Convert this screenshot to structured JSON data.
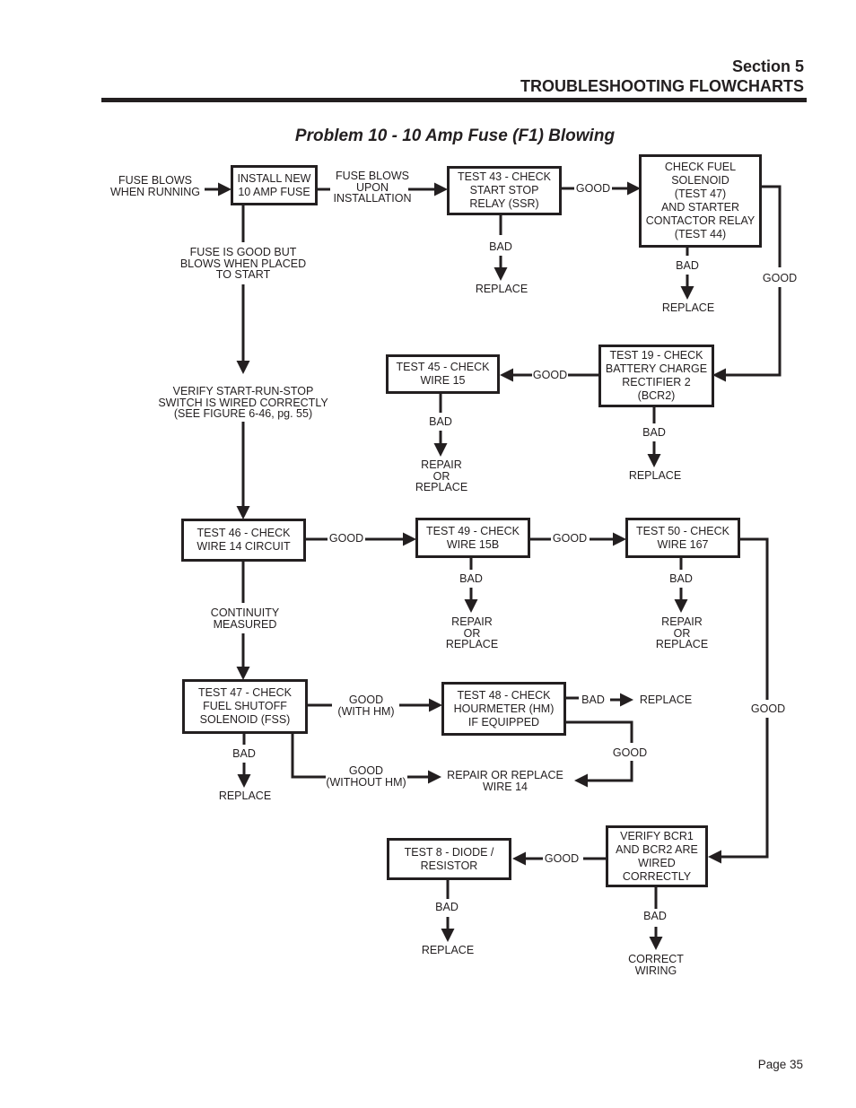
{
  "header": {
    "section": "Section 5",
    "chapter": "TROUBLESHOOTING FLOWCHARTS"
  },
  "title": "Problem 10 -  10 Amp Fuse (F1) Blowing",
  "boxes": {
    "install": "INSTALL NEW\n10 AMP FUSE",
    "t43": "TEST 43 - CHECK\nSTART STOP\nRELAY (SSR)",
    "fuel": "CHECK FUEL\nSOLENOID\n(TEST 47)\nAND STARTER\nCONTACTOR RELAY\n(TEST 44)",
    "t19": "TEST 19 - CHECK\nBATTERY CHARGE\nRECTIFIER 2\n(BCR2)",
    "t45": "TEST 45 - CHECK\nWIRE 15",
    "t46": "TEST 46 - CHECK\nWIRE 14 CIRCUIT",
    "t49": "TEST 49 - CHECK\nWIRE 15B",
    "t50": "TEST 50 - CHECK\nWIRE 167",
    "t47": "TEST 47 - CHECK\nFUEL SHUTOFF\nSOLENOID (FSS)",
    "t48": "TEST 48 - CHECK\nHOURMETER (HM)\nIF EQUIPPED",
    "verify": "VERIFY BCR1\nAND BCR2 ARE\nWIRED\nCORRECTLY",
    "t8": "TEST 8 - DIODE /\nRESISTOR"
  },
  "labels": {
    "blows_running": "FUSE BLOWS\nWHEN RUNNING",
    "blows_install": "FUSE BLOWS\nUPON\nINSTALLATION",
    "good_t43": "GOOD",
    "bad_t43": "BAD",
    "replace_t43": "REPLACE",
    "bad_fuel": "BAD",
    "replace_fuel": "REPLACE",
    "good_fuel": "GOOD",
    "fuse_good": "FUSE IS GOOD BUT\nBLOWS WHEN PLACED\nTO START",
    "verify_switch": "VERIFY START-RUN-STOP\nSWITCH IS WIRED CORRECTLY\n(SEE FIGURE 6-46, pg. 55)",
    "good_t19": "GOOD",
    "bad_t45": "BAD",
    "repair_t45": "REPAIR\nOR\nREPLACE",
    "bad_t19": "BAD",
    "replace_t19": "REPLACE",
    "good_t46": "GOOD",
    "good_t49": "GOOD",
    "bad_t49": "BAD",
    "repair_t49": "REPAIR\nOR\nREPLACE",
    "bad_t50": "BAD",
    "repair_t50": "REPAIR\nOR\nREPLACE",
    "continuity": "CONTINUITY\nMEASURED",
    "good_with_hm": "GOOD\n(WITH HM)",
    "bad_t48": "BAD",
    "replace_t48": "REPLACE",
    "good_t50": "GOOD",
    "good_t48": "GOOD",
    "bad_t47": "BAD",
    "replace_t47": "REPLACE",
    "good_without_hm": "GOOD\n(WITHOUT HM)",
    "repair_wire14": "REPAIR OR REPLACE\nWIRE 14",
    "good_verify": "GOOD",
    "bad_t8": "BAD",
    "replace_t8": "REPLACE",
    "bad_verify": "BAD",
    "correct_wiring": "CORRECT\nWIRING"
  },
  "footer": {
    "page": "Page 35"
  },
  "colors": {
    "ink": "#231f20"
  }
}
